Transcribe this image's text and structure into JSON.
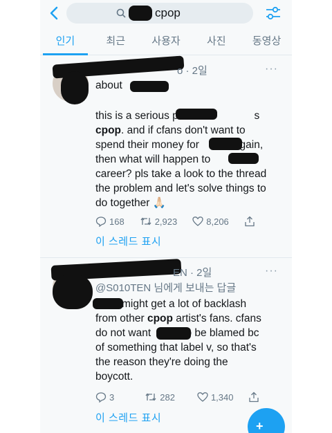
{
  "search": {
    "query": "cpop"
  },
  "tabs": [
    {
      "label": "인기"
    },
    {
      "label": "최근"
    },
    {
      "label": "사용자"
    },
    {
      "label": "사진"
    },
    {
      "label": "동영상"
    }
  ],
  "tweets": [
    {
      "header_suffix": "o · 2일",
      "about": "about",
      "body_line1_pre": "this is a serious problem.",
      "body_line1_post": "s",
      "body_bold": "cpop",
      "body_line2_post": ". and if cfans don't want to",
      "body_line3_pre": "spend their money for",
      "body_line3_post": "again,",
      "body_line4": "then what will happen to",
      "body_line5": "career? pls take a look to the thread",
      "body_line6": "the problem and let's solve things to",
      "body_line7": "do together 🙏🏻",
      "replies": "168",
      "retweets": "2,923",
      "likes": "8,206",
      "thread_link": "이 스레드 표시"
    },
    {
      "header_suffix": "EN · 2일",
      "reply_to": "@S010TEN 님에게 보내는 답글",
      "body_line1_post": "might get a lot of backlash",
      "body_line2_pre": "from other ",
      "body_bold": "cpop",
      "body_line2_post": " artist's fans. cfans",
      "body_line3_pre": "do not want",
      "body_line3_post": "to be blamed bc",
      "body_line4": "of something that label v, so that's",
      "body_line5": "the reason they're doing the",
      "body_line6": "boycott.",
      "replies": "3",
      "retweets": "282",
      "likes": "1,340",
      "thread_link": "이 스레드 표시"
    }
  ],
  "fab": {
    "label": "+"
  },
  "colors": {
    "accent": "#1da1f2",
    "muted": "#657786",
    "text": "#14171a",
    "background": "#f7f9fa"
  }
}
